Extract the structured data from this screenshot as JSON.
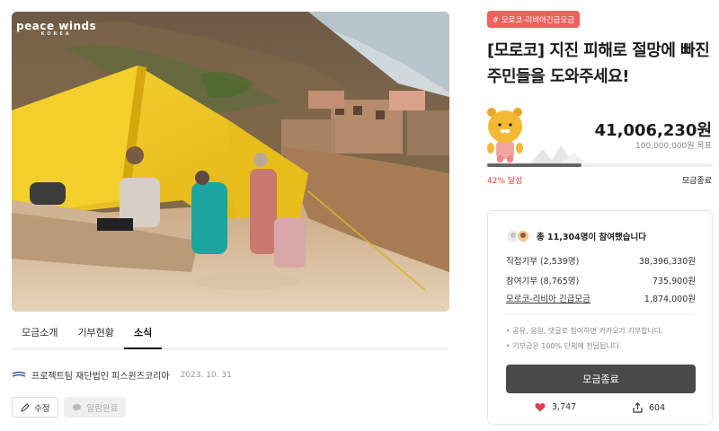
{
  "hero": {
    "logo_text": "peace winds",
    "logo_sub": "KOREA"
  },
  "tabs": [
    {
      "label": "모금소개"
    },
    {
      "label": "기부현황"
    },
    {
      "label": "소식"
    }
  ],
  "post": {
    "author": "프로젝트팀 재단법인 피스윈즈코리아",
    "date": "2023. 10. 31"
  },
  "actions": {
    "edit": "수정",
    "alarm": "알림완료"
  },
  "campaign": {
    "tag": "# 모로코-리비아긴급모금",
    "title": "[모로코] 지진 피해로 절망에 빠진 주민들을 도와주세요!",
    "amount": "41,006,230원",
    "goal": "100,000,000원 목표",
    "progress": 42,
    "progress_label": "42% 달성",
    "status": "모금종료"
  },
  "panel": {
    "participants": "총 11,304명이 참여했습니다",
    "rows": [
      {
        "label": "직접기부 (2,539명)",
        "value": "38,396,330원"
      },
      {
        "label": "참여기부 (8,765명)",
        "value": "735,900원"
      },
      {
        "label": "모로코-리비아 긴급모금",
        "value": "1,874,000원"
      }
    ],
    "notes": [
      "• 공유, 응원, 댓글로 참여하면 카카오가 기부합니다.",
      "• 기부금은 100% 단체에 전달됩니다."
    ],
    "ended_button": "모금종료",
    "likes": "3,747",
    "shares": "604"
  },
  "colors": {
    "accent": "#f25f5c",
    "progress": "#666666",
    "button": "#4a4a4a",
    "heart": "#e53950"
  }
}
